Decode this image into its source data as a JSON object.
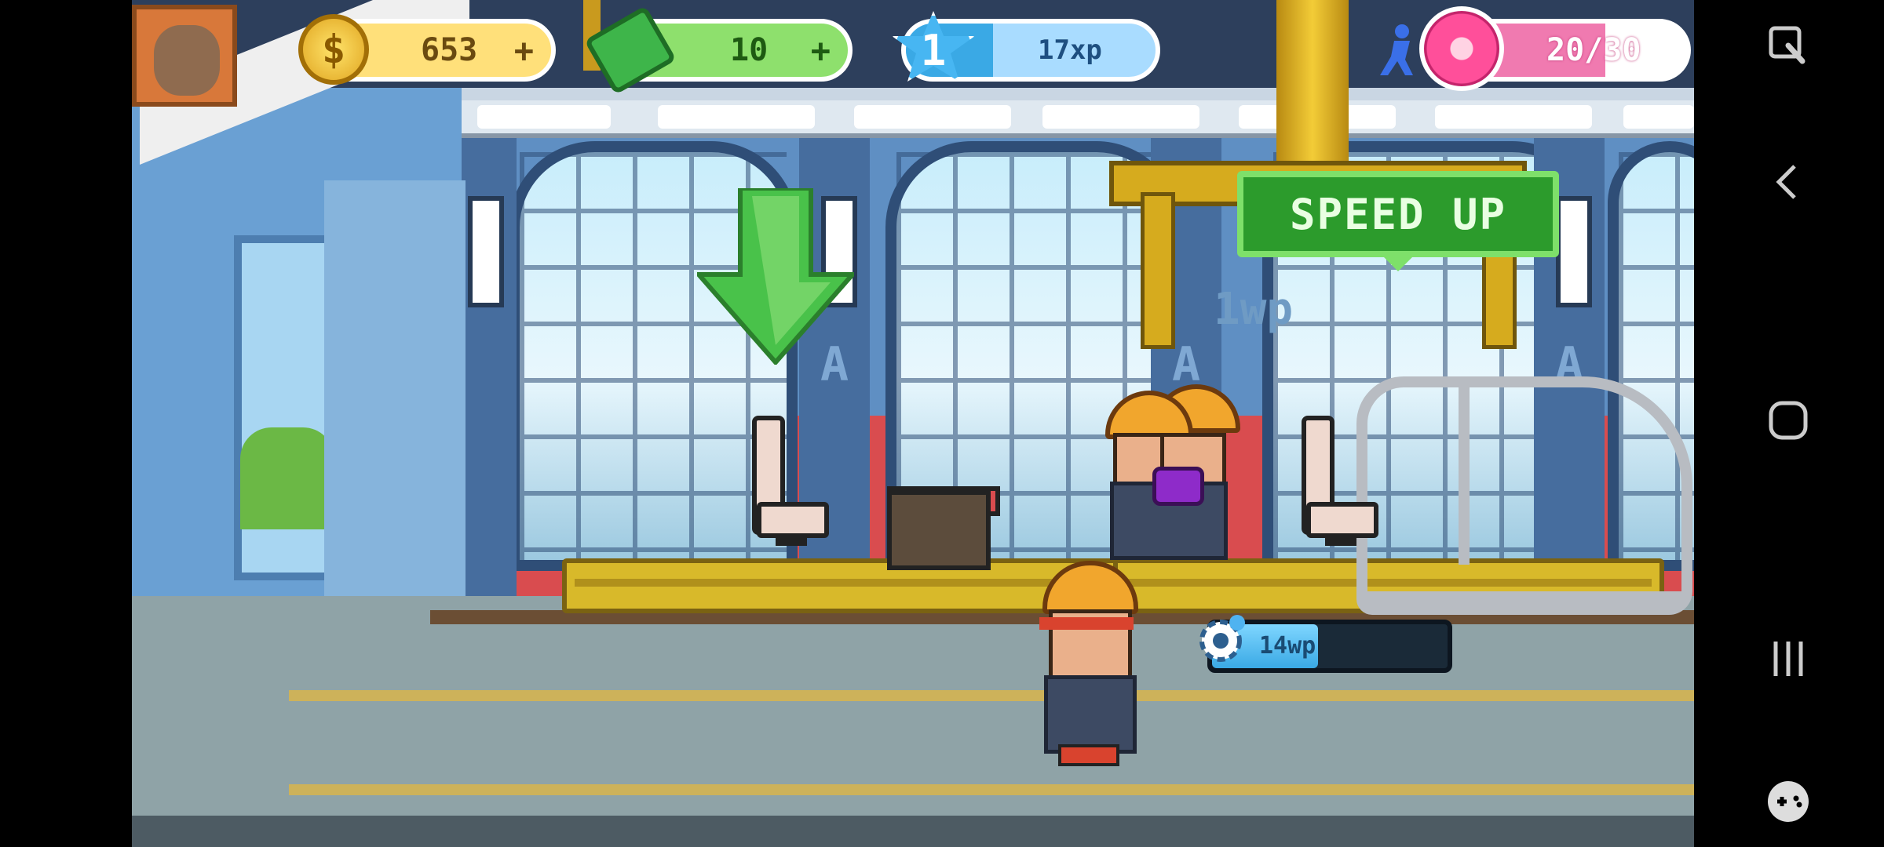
{
  "hud": {
    "coins": "653",
    "cash": "10",
    "level": "1",
    "xp_label": "17xp",
    "xp_fraction": 0.35,
    "donuts_label": "20/30",
    "donut_fraction": 0.6667,
    "coins_add": "+",
    "cash_add": "+"
  },
  "scene": {
    "speed_up_label": "SPEED UP",
    "work_points_float": "1wp",
    "work_progress_label": "14wp",
    "work_progress_fraction": 0.45,
    "pillar_letters": [
      "A",
      "A",
      "A"
    ]
  },
  "colors": {
    "accent_green": "#2c9b2c",
    "coin_yellow": "#ffe07a",
    "xp_blue": "#3aa9e5",
    "donut_pink": "#f07ab0"
  },
  "android_nav": {
    "icons": [
      "screen-record-icon",
      "back-icon",
      "home-icon",
      "recents-icon",
      "game-tools-icon"
    ]
  }
}
